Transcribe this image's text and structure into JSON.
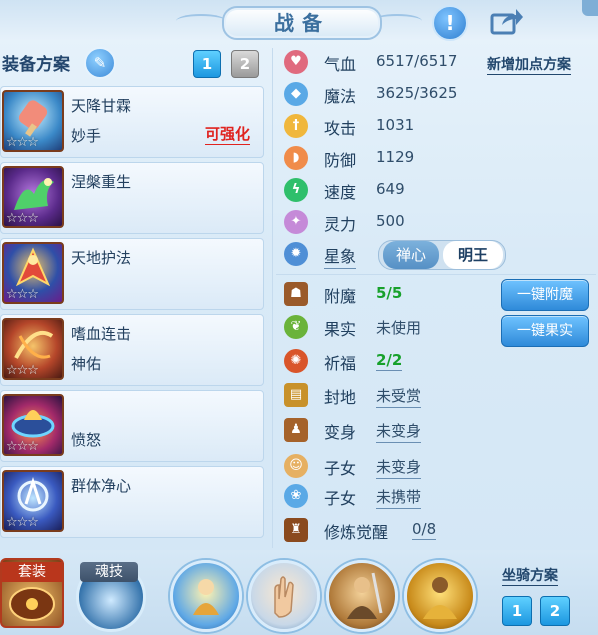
{
  "header": {
    "title": "战备",
    "hint_icon": "exclamation-icon",
    "share_icon": "share-icon"
  },
  "equipment": {
    "title": "装备方案",
    "tabs": [
      "1",
      "2"
    ],
    "active_tab": "1"
  },
  "skills": [
    {
      "name": "天降甘霖",
      "sub": "妙手",
      "action": "可强化",
      "stars": "☆☆☆",
      "icon": "popsicle-icon"
    },
    {
      "name": "涅槃重生",
      "sub": "",
      "action": "",
      "stars": "☆☆☆",
      "icon": "phoenix-icon"
    },
    {
      "name": "天地护法",
      "sub": "",
      "action": "",
      "stars": "☆☆☆",
      "icon": "guardian-icon"
    },
    {
      "name": "嗜血连击",
      "sub": "神佑",
      "action": "",
      "stars": "☆☆☆",
      "icon": "blood-strike-icon"
    },
    {
      "name": "",
      "sub": "愤怒",
      "action": "",
      "stars": "☆☆☆",
      "icon": "fire-cauldron-icon"
    },
    {
      "name": "群体净心",
      "sub": "",
      "action": "",
      "stars": "☆☆☆",
      "icon": "purify-icon"
    }
  ],
  "stats": [
    {
      "label": "气血",
      "value": "6517/6517",
      "icon": "heart-icon",
      "color": "#e06a7e"
    },
    {
      "label": "魔法",
      "value": "3625/3625",
      "icon": "mana-icon",
      "color": "#5aa9e6"
    },
    {
      "label": "攻击",
      "value": "1031",
      "icon": "sword-icon",
      "color": "#f0b73c"
    },
    {
      "label": "防御",
      "value": "1129",
      "icon": "shield-icon",
      "color": "#f08c4a"
    },
    {
      "label": "速度",
      "value": "649",
      "icon": "lightning-icon",
      "color": "#2fbf6b"
    },
    {
      "label": "灵力",
      "value": "500",
      "icon": "spirit-icon",
      "color": "#c58ad8"
    }
  ],
  "add_plan_link": "新增加点方案",
  "constellation": {
    "label": "星象",
    "options": [
      "禅心",
      "明王"
    ],
    "selected": "明王"
  },
  "extras": [
    {
      "label": "附魔",
      "value": "5/5",
      "green": true,
      "underline": false
    },
    {
      "label": "果实",
      "value": "未使用",
      "green": false,
      "underline": false
    },
    {
      "label": "祈福",
      "value": "2/2",
      "green": true,
      "underline": true
    },
    {
      "label": "封地",
      "value": "未受赏",
      "green": false,
      "underline": true
    },
    {
      "label": "变身",
      "value": "未变身",
      "green": false,
      "underline": true
    },
    {
      "label": "子女",
      "value": "未变身",
      "green": false,
      "underline": true
    },
    {
      "label": "子女",
      "value": "未携带",
      "green": false,
      "underline": true
    },
    {
      "label": "修炼觉醒",
      "value": "0/8",
      "green": false,
      "underline": true
    }
  ],
  "buttons": {
    "one_click_enchant": "一键附魔",
    "one_click_fruit": "一键果实"
  },
  "bottom": {
    "suit_label": "套装",
    "soul_label": "魂技",
    "mount_title": "坐骑方案",
    "mount_tabs": [
      "1",
      "2"
    ]
  }
}
